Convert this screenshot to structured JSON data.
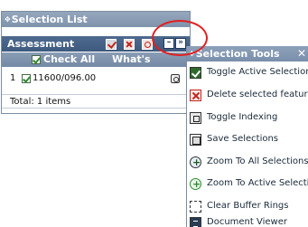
{
  "selection_list": {
    "title": "Selection List",
    "title_icon": "diamond-icon",
    "assessment_label": "Assessment",
    "header": {
      "check_all": "Check All",
      "whats_nearby": "What's Nearby"
    },
    "rows": [
      {
        "index": "1",
        "id": "11600/096.00",
        "checked": true
      }
    ],
    "total": "Total: 1 items",
    "toolbar_icons": [
      "checkmark-icon",
      "delete-x-icon",
      "zoom-icon"
    ],
    "buttons": {
      "minimize": "–",
      "expand": "»"
    }
  },
  "selection_tools": {
    "title": "Selection Tools",
    "close": "✕",
    "items": [
      {
        "label": "Toggle Active Selection",
        "icon": "toggle-active-icon"
      },
      {
        "label": "Delete selected features",
        "icon": "delete-icon"
      },
      {
        "label": "Toggle Indexing",
        "icon": "indexing-icon"
      },
      {
        "label": "Save Selections",
        "icon": "save-icon"
      },
      {
        "label": "Zoom To All Selections",
        "icon": "zoom-all-icon"
      },
      {
        "label": "Zoom To Active Selections",
        "icon": "zoom-active-icon"
      },
      {
        "label": "Clear Buffer Rings",
        "icon": "clear-buffer-icon"
      },
      {
        "label": "Document Viewer",
        "icon": "document-viewer-icon"
      }
    ]
  },
  "colors": {
    "panel_header": "#8a9db6",
    "assessment_bar": "#4e6a8e",
    "highlight": "#e02020"
  }
}
